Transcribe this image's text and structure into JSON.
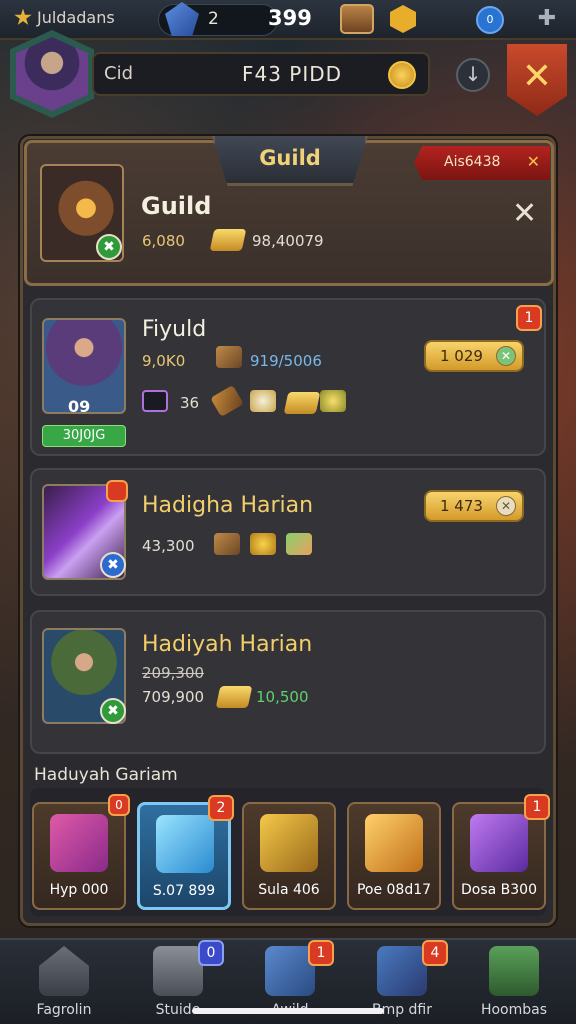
{
  "topbar": {
    "app_name": "Juldadans",
    "gem_count": "2",
    "coin_count": "399",
    "blue_button": "0"
  },
  "header": {
    "player_label": "Cid",
    "player_id": "F43 PIDD"
  },
  "panel": {
    "tab_title": "Guild",
    "ribbon_text": "Ais6438"
  },
  "guild_card": {
    "title": "Guild",
    "value_gold": "6,080",
    "value_total": "98,40079"
  },
  "quests": [
    {
      "title": "Fiyuld",
      "value_gold": "9,0K0",
      "value_blue": "919/5006",
      "progress": "1 029",
      "level": "09",
      "green_tag": "30J0JG",
      "small_value": "36",
      "badge": "1"
    },
    {
      "title": "Hadigha Harian",
      "value": "43,300",
      "progress": "1 473"
    },
    {
      "title": "Hadiyah Harian",
      "value_strike": "209,300",
      "value": "709,900",
      "value_green": "10,500"
    }
  ],
  "rewards_section": {
    "label": "Haduyah Gariam",
    "items": [
      {
        "label": "Hyp 000",
        "badge": "0"
      },
      {
        "label": "S.07 899",
        "badge": "2"
      },
      {
        "label": "Sula 406",
        "badge": ""
      },
      {
        "label": "Poe 08d17",
        "badge": ""
      },
      {
        "label": "Dosa B300",
        "badge": "1"
      }
    ]
  },
  "bottom_nav": [
    {
      "label": "Fagrolin",
      "badge": ""
    },
    {
      "label": "Stuide",
      "badge": "0"
    },
    {
      "label": "Awild",
      "badge": "1"
    },
    {
      "label": "Bmp dfir",
      "badge": "4"
    },
    {
      "label": "Hoombas",
      "badge": ""
    }
  ],
  "colors": {
    "accent_gold": "#f2cf6a",
    "panel_border": "#5c4a33",
    "ribbon_red": "#b3231f",
    "selected_blue": "#7fc8f4"
  }
}
